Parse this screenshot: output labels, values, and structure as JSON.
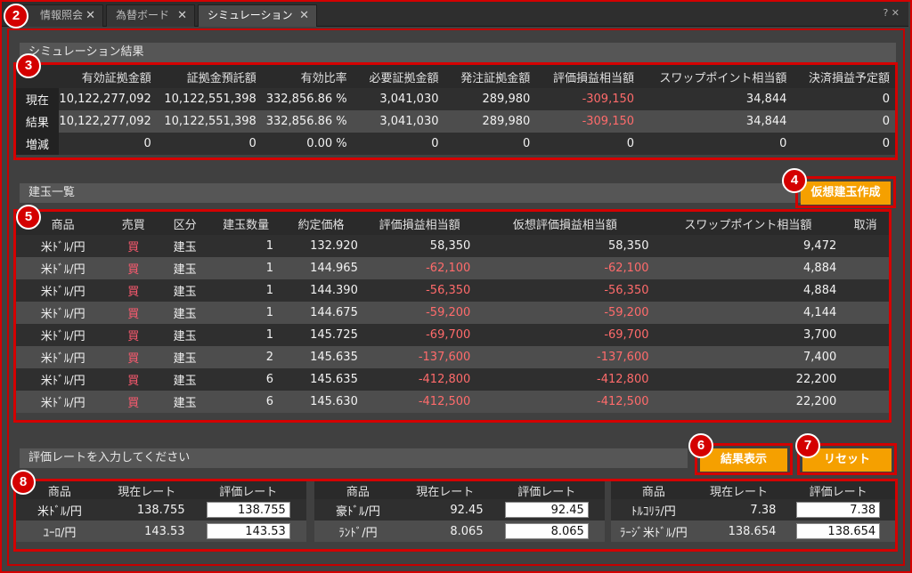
{
  "tabs": [
    {
      "label": "情報照会",
      "close": "✕"
    },
    {
      "label": "為替ボード",
      "close": "✕"
    },
    {
      "label": "シミュレーション",
      "close": "✕"
    }
  ],
  "window_icons": "? ✕",
  "simulation_result": {
    "title": "シミュレーション結果",
    "headers": [
      "",
      "有効証拠金額",
      "証拠金預託額",
      "有効比率",
      "必要証拠金額",
      "発注証拠金額",
      "評価損益相当額",
      "スワップポイント相当額",
      "決済損益予定額"
    ],
    "rows": [
      {
        "label": "現在",
        "values": [
          "10,122,277,092",
          "10,122,551,398",
          "332,856.86 %",
          "3,041,030",
          "289,980",
          "-309,150",
          "34,844",
          "0"
        ]
      },
      {
        "label": "結果",
        "values": [
          "10,122,277,092",
          "10,122,551,398",
          "332,856.86 %",
          "3,041,030",
          "289,980",
          "-309,150",
          "34,844",
          "0"
        ]
      },
      {
        "label": "増減",
        "values": [
          "0",
          "0",
          "0.00 %",
          "0",
          "0",
          "0",
          "0",
          "0"
        ]
      }
    ]
  },
  "positions": {
    "title": "建玉一覧",
    "create_button": "仮想建玉作成",
    "headers": [
      "商品",
      "売買",
      "区分",
      "建玉数量",
      "約定価格",
      "評価損益相当額",
      "仮想評価損益相当額",
      "スワップポイント相当額",
      "取消"
    ],
    "rows": [
      {
        "product": "米ﾄﾞﾙ/円",
        "side": "買",
        "type": "建玉",
        "qty": "1",
        "price": "132.920",
        "pl": "58,350",
        "vpl": "58,350",
        "swap": "9,472"
      },
      {
        "product": "米ﾄﾞﾙ/円",
        "side": "買",
        "type": "建玉",
        "qty": "1",
        "price": "144.965",
        "pl": "-62,100",
        "vpl": "-62,100",
        "swap": "4,884"
      },
      {
        "product": "米ﾄﾞﾙ/円",
        "side": "買",
        "type": "建玉",
        "qty": "1",
        "price": "144.390",
        "pl": "-56,350",
        "vpl": "-56,350",
        "swap": "4,884"
      },
      {
        "product": "米ﾄﾞﾙ/円",
        "side": "買",
        "type": "建玉",
        "qty": "1",
        "price": "144.675",
        "pl": "-59,200",
        "vpl": "-59,200",
        "swap": "4,144"
      },
      {
        "product": "米ﾄﾞﾙ/円",
        "side": "買",
        "type": "建玉",
        "qty": "1",
        "price": "145.725",
        "pl": "-69,700",
        "vpl": "-69,700",
        "swap": "3,700"
      },
      {
        "product": "米ﾄﾞﾙ/円",
        "side": "買",
        "type": "建玉",
        "qty": "2",
        "price": "145.635",
        "pl": "-137,600",
        "vpl": "-137,600",
        "swap": "7,400"
      },
      {
        "product": "米ﾄﾞﾙ/円",
        "side": "買",
        "type": "建玉",
        "qty": "6",
        "price": "145.635",
        "pl": "-412,800",
        "vpl": "-412,800",
        "swap": "22,200"
      },
      {
        "product": "米ﾄﾞﾙ/円",
        "side": "買",
        "type": "建玉",
        "qty": "6",
        "price": "145.630",
        "pl": "-412,500",
        "vpl": "-412,500",
        "swap": "22,200"
      }
    ]
  },
  "rate_input": {
    "title": "評価レートを入力してください",
    "show_button": "結果表示",
    "reset_button": "リセット",
    "headers": [
      "商品",
      "現在レート",
      "評価レート"
    ],
    "panels": [
      [
        {
          "product": "米ﾄﾞﾙ/円",
          "current": "138.755",
          "eval": "138.755"
        },
        {
          "product": "ﾕｰﾛ/円",
          "current": "143.53",
          "eval": "143.53"
        }
      ],
      [
        {
          "product": "豪ﾄﾞﾙ/円",
          "current": "92.45",
          "eval": "92.45"
        },
        {
          "product": "ﾗﾝﾄﾞ/円",
          "current": "8.065",
          "eval": "8.065"
        }
      ],
      [
        {
          "product": "ﾄﾙｺﾘﾗ/円",
          "current": "7.38",
          "eval": "7.38"
        },
        {
          "product": "ﾗｰｼﾞ米ﾄﾞﾙ/円",
          "current": "138.654",
          "eval": "138.654"
        }
      ]
    ]
  },
  "badges": [
    "2",
    "3",
    "4",
    "5",
    "6",
    "7",
    "8"
  ],
  "colors": {
    "accent": "#f5a000",
    "highlight": "#d40000",
    "negative": "#ff6b6b"
  }
}
